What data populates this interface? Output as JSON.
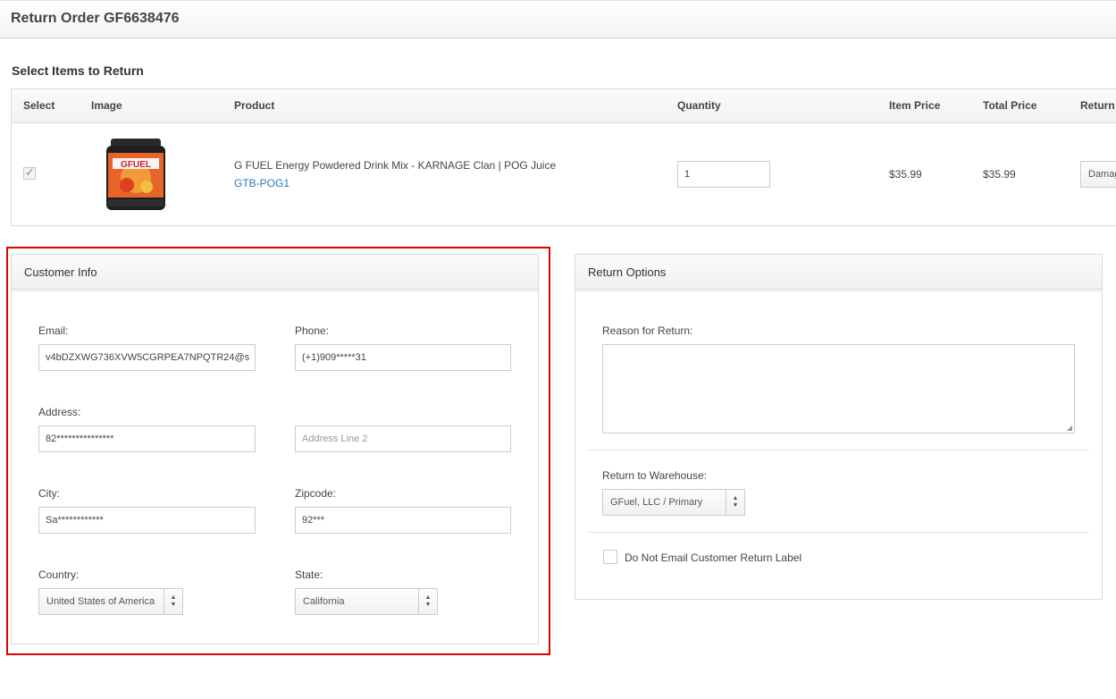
{
  "header": {
    "title": "Return Order GF6638476"
  },
  "items_section": {
    "title": "Select Items to Return",
    "columns": [
      "Select",
      "Image",
      "Product",
      "Quantity",
      "Item Price",
      "Total Price",
      "Return"
    ],
    "rows": [
      {
        "selected": true,
        "image_alt": "G FUEL Karnage tub",
        "product_name": "G FUEL Energy Powdered Drink Mix - KARNAGE Clan | POG Juice",
        "sku": "GTB-POG1",
        "quantity": "1",
        "item_price": "$35.99",
        "total_price": "$35.99",
        "return_reason": "Damag"
      }
    ]
  },
  "customer_info": {
    "title": "Customer Info",
    "email_label": "Email:",
    "email_value": "v4bDZXWG736XVW5CGRPEA7NPQTR24@s",
    "phone_label": "Phone:",
    "phone_value": "(+1)909*****31",
    "address_label": "Address:",
    "address_value": "82***************",
    "address2_placeholder": "Address Line 2",
    "city_label": "City:",
    "city_value": "Sa************",
    "zipcode_label": "Zipcode:",
    "zipcode_value": "92***",
    "country_label": "Country:",
    "country_value": "United States of America",
    "state_label": "State:",
    "state_value": "California"
  },
  "return_options": {
    "title": "Return Options",
    "reason_label": "Reason for Return:",
    "reason_value": "",
    "warehouse_label": "Return to Warehouse:",
    "warehouse_value": "GFuel, LLC / Primary",
    "no_email_label": "Do Not Email Customer Return Label",
    "no_email_checked": false
  },
  "colors": {
    "highlight": "#e00000",
    "link": "#2a7ab8"
  },
  "icons": {
    "checkbox_checked": "check-icon",
    "select_arrows": "sort-arrows-icon",
    "resize": "resize-grip-icon"
  }
}
